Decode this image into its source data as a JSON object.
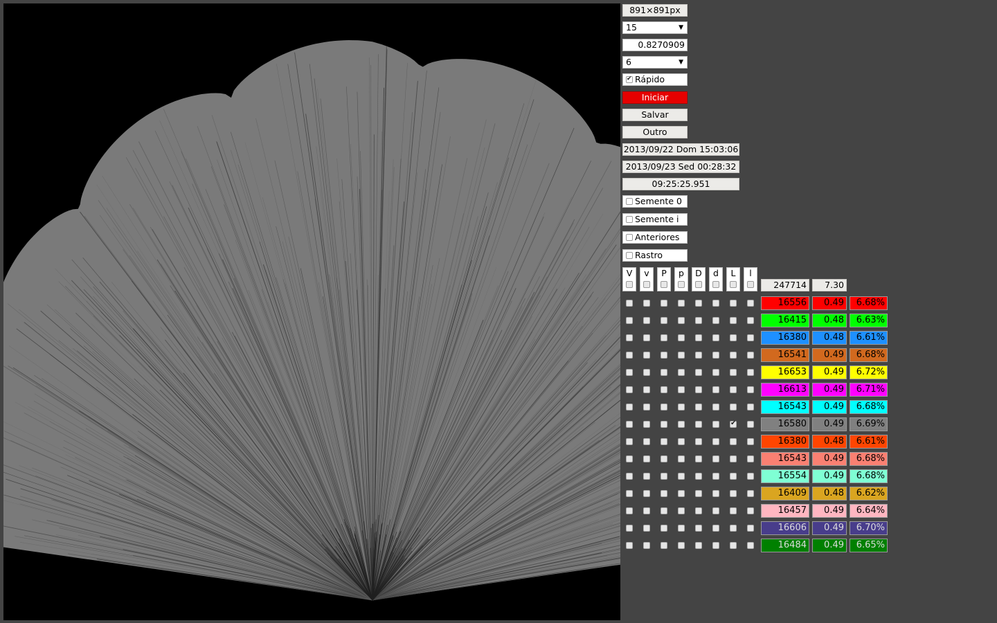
{
  "canvas": {
    "background": "#000000",
    "fan_color": "#7a7a7a"
  },
  "controls": {
    "size_label": "891×891px",
    "select1_value": "15",
    "number_value": "0.8270909",
    "select2_value": "6",
    "fast_label": "Rápido",
    "fast_checked": true,
    "start_label": "Iniciar",
    "save_label": "Salvar",
    "other_label": "Outro",
    "start_time": "2013/09/22 Dom 15:03:06",
    "end_time": "2013/09/23 Sed 00:28:32",
    "elapsed": "09:25:25.951",
    "seed0_label": "Semente 0",
    "seedi_label": "Semente i",
    "previous_label": "Anteriores",
    "trail_label": "Rastro"
  },
  "grid": {
    "column_headers": [
      "V",
      "v",
      "P",
      "p",
      "D",
      "d",
      "L",
      "l"
    ],
    "total": "247714",
    "total_avg": "7.30",
    "rows": [
      {
        "color": "#ff0000",
        "count": "16556",
        "avg": "0.49",
        "pct": "6.68%",
        "checked": []
      },
      {
        "color": "#00ff00",
        "count": "16415",
        "avg": "0.48",
        "pct": "6.63%",
        "checked": []
      },
      {
        "color": "#1e90ff",
        "count": "16380",
        "avg": "0.48",
        "pct": "6.61%",
        "checked": []
      },
      {
        "color": "#d2691e",
        "count": "16541",
        "avg": "0.49",
        "pct": "6.68%",
        "checked": []
      },
      {
        "color": "#ffff00",
        "count": "16653",
        "avg": "0.49",
        "pct": "6.72%",
        "checked": []
      },
      {
        "color": "#ff00ff",
        "count": "16613",
        "avg": "0.49",
        "pct": "6.71%",
        "checked": []
      },
      {
        "color": "#00ffff",
        "count": "16543",
        "avg": "0.49",
        "pct": "6.68%",
        "checked": []
      },
      {
        "color": "#808080",
        "count": "16580",
        "avg": "0.49",
        "pct": "6.69%",
        "checked": [
          6
        ]
      },
      {
        "color": "#ff4500",
        "count": "16380",
        "avg": "0.48",
        "pct": "6.61%",
        "checked": []
      },
      {
        "color": "#fa8072",
        "count": "16543",
        "avg": "0.49",
        "pct": "6.68%",
        "checked": []
      },
      {
        "color": "#7fffd4",
        "count": "16554",
        "avg": "0.49",
        "pct": "6.68%",
        "checked": []
      },
      {
        "color": "#daa520",
        "count": "16409",
        "avg": "0.48",
        "pct": "6.62%",
        "checked": []
      },
      {
        "color": "#ffb6c1",
        "count": "16457",
        "avg": "0.49",
        "pct": "6.64%",
        "checked": []
      },
      {
        "color": "#483d8b",
        "count": "16606",
        "avg": "0.49",
        "pct": "6.70%",
        "checked": []
      },
      {
        "color": "#008000",
        "count": "16484",
        "avg": "0.49",
        "pct": "6.65%",
        "checked": []
      }
    ]
  }
}
